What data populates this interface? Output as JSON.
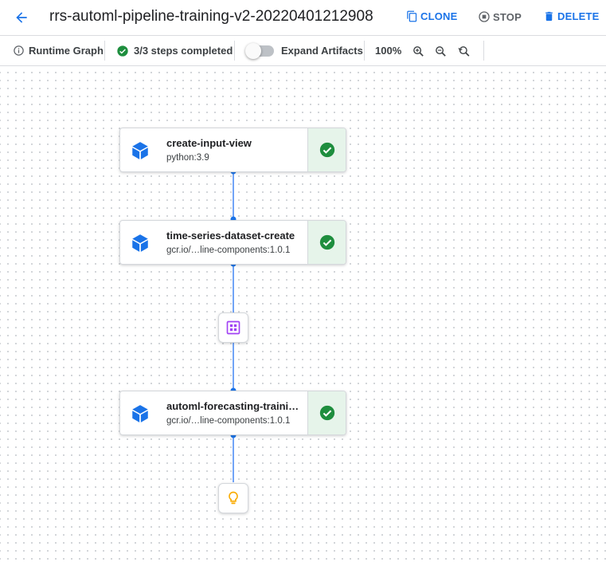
{
  "header": {
    "title": "rrs-automl-pipeline-training-v2-20220401212908",
    "clone_label": "CLONE",
    "stop_label": "STOP",
    "delete_label": "DELETE"
  },
  "toolbar": {
    "runtime_graph_label": "Runtime Graph",
    "steps_completed": "3/3 steps completed",
    "expand_artifacts_label": "Expand Artifacts",
    "expand_artifacts_on": false,
    "zoom_level": "100%"
  },
  "graph": {
    "nodes": [
      {
        "name": "create-input-view",
        "image": "python:3.9",
        "status": "succeeded"
      },
      {
        "name": "time-series-dataset-create",
        "image": "gcr.io/…line-components:1.0.1",
        "status": "succeeded"
      },
      {
        "name": "automl-forecasting-traini…",
        "image": "gcr.io/…line-components:1.0.1",
        "status": "succeeded"
      }
    ],
    "artifacts": [
      {
        "icon": "dataset-icon",
        "color": "#a142f4"
      },
      {
        "icon": "lightbulb-icon",
        "color": "#f9ab00"
      }
    ]
  },
  "colors": {
    "accent": "#1a73e8",
    "success": "#1e8e3e",
    "success_bg": "#e6f4ea",
    "node_icon": "#1a73e8",
    "edge": "#4285f4"
  }
}
